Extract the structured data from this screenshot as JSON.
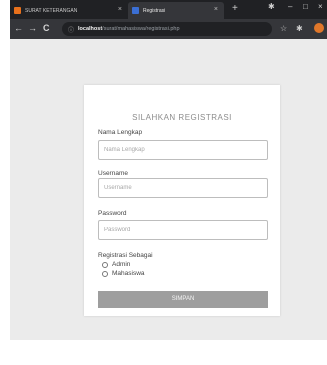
{
  "browser": {
    "tabs": [
      {
        "label": "SURAT KETERANGAN"
      },
      {
        "label": "Registrasi"
      }
    ],
    "new_tab": "+",
    "close_glyph": "×",
    "url_host": "localhost",
    "url_path": "/surat/mahasiswa/registrasi.php",
    "controls": {
      "minimize": "–",
      "maximize": "□",
      "close": "×"
    },
    "nav": {
      "back": "←",
      "forward": "→",
      "reload": "C",
      "info": "ⓘ"
    },
    "icons": {
      "star": "☆",
      "extensions": "✱",
      "menu": "⋮",
      "settings": "✱"
    }
  },
  "form": {
    "title": "SILAHKAN REGISTRASI",
    "fields": [
      {
        "label": "Nama Lengkap",
        "placeholder": "Nama Lengkap",
        "value": ""
      },
      {
        "label": "Username",
        "placeholder": "Username",
        "value": ""
      },
      {
        "label": "Password",
        "placeholder": "Password",
        "value": ""
      }
    ],
    "role_label": "Registrasi Sebagai",
    "roles": [
      {
        "label": "Admin",
        "checked": false
      },
      {
        "label": "Mahasiswa",
        "checked": false
      }
    ],
    "submit_label": "SIMPAN"
  }
}
